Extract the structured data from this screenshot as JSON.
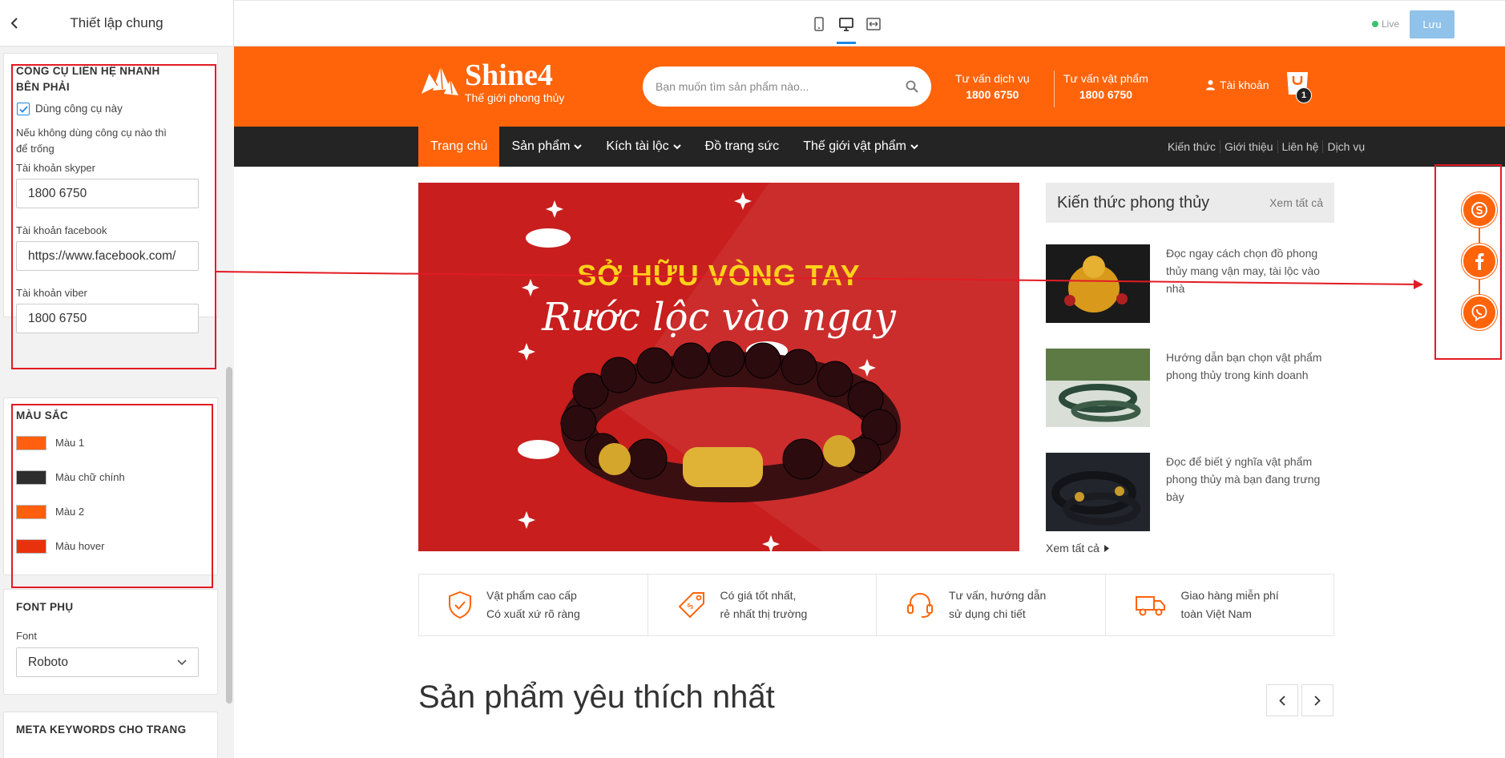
{
  "sidebar": {
    "title": "Thiết lập chung",
    "quick_contact": {
      "title": "CÔNG CỤ LIÊN HỆ NHANH BÊN PHẢI",
      "enable_label": "Dùng công cụ này",
      "enabled": true,
      "hint": "Nếu không dùng công cụ nào thì để trống",
      "skype_label": "Tài khoản skyper",
      "skype_value": "1800 6750",
      "facebook_label": "Tài khoản facebook",
      "facebook_value": "https://www.facebook.com/",
      "viber_label": "Tài khoản viber",
      "viber_value": "1800 6750"
    },
    "colors": {
      "title": "MÀU SẮC",
      "items": [
        {
          "label": "Màu 1",
          "color": "#ff5f0f"
        },
        {
          "label": "Màu chữ chính",
          "color": "#2e2e2e"
        },
        {
          "label": "Màu 2",
          "color": "#ff5f0f"
        },
        {
          "label": "Màu hover",
          "color": "#e8320e"
        }
      ]
    },
    "font": {
      "title": "FONT PHỤ",
      "label": "Font",
      "value": "Roboto"
    },
    "meta": {
      "title": "META KEYWORDS CHO TRANG"
    }
  },
  "topbar": {
    "devices": [
      "mobile-icon",
      "desktop-icon",
      "fullwidth-icon"
    ],
    "active_device": "desktop-icon",
    "live_label": "Live",
    "save_label": "Lưu"
  },
  "site": {
    "logo_name": "Shine4",
    "logo_tagline": "Thế giới phong thủy",
    "search_placeholder": "Bạn muốn tìm sản phẩm nào...",
    "hotlines": [
      {
        "label": "Tư vấn dịch vụ",
        "phone": "1800 6750"
      },
      {
        "label": "Tư vấn vật phẩm",
        "phone": "1800 6750"
      }
    ],
    "account_label": "Tài khoản",
    "cart_count": "1",
    "nav": [
      {
        "label": "Trang chủ",
        "dropdown": false
      },
      {
        "label": "Sản phẩm",
        "dropdown": true
      },
      {
        "label": "Kích tài lộc",
        "dropdown": true
      },
      {
        "label": "Đồ trang sức",
        "dropdown": false
      },
      {
        "label": "Thế giới vật phẩm",
        "dropdown": true
      }
    ],
    "nav_secondary": [
      "Kiến thức",
      "Giới thiệu",
      "Liên hệ",
      "Dịch vụ"
    ],
    "banner": {
      "line1": "SỞ HỮU VÒNG TAY",
      "line2": "Rước lộc vào ngay"
    },
    "knowledge": {
      "title": "Kiến thức phong thủy",
      "view_all": "Xem tất cả",
      "items": [
        "Đọc ngay cách chọn đồ phong thủy mang vận may, tài lộc vào nhà",
        "Hướng dẫn bạn chọn vật phẩm phong thủy trong kinh doanh",
        "Đọc để biết ý nghĩa vật phẩm phong thủy mà bạn đang trưng bày"
      ],
      "more": "Xem tất cả"
    },
    "features": [
      {
        "line1": "Vật phẩm cao cấp",
        "line2": "Có xuất xứ rõ ràng",
        "icon": "shield-check-icon"
      },
      {
        "line1": "Có giá tốt nhất,",
        "line2": "rẻ nhất thị trường",
        "icon": "price-tag-icon"
      },
      {
        "line1": "Tư vấn, hướng dẫn",
        "line2": "sử dụng chi tiết",
        "icon": "headset-icon"
      },
      {
        "line1": "Giao hàng miễn phí",
        "line2": "toàn Việt Nam",
        "icon": "truck-icon"
      }
    ],
    "section_title": "Sản phẩm yêu thích nhất",
    "floating_contacts": [
      "skype-icon",
      "facebook-icon",
      "viber-icon"
    ],
    "accent": "#ff640a"
  }
}
